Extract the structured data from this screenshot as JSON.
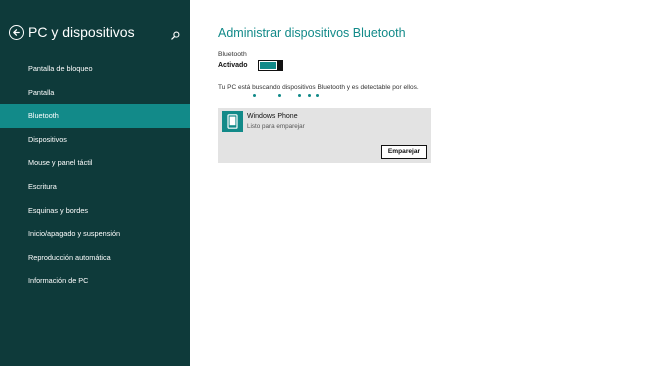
{
  "sidebar": {
    "title": "PC y dispositivos",
    "items": [
      {
        "label": "Pantalla de bloqueo"
      },
      {
        "label": "Pantalla"
      },
      {
        "label": "Bluetooth"
      },
      {
        "label": "Dispositivos"
      },
      {
        "label": "Mouse y panel táctil"
      },
      {
        "label": "Escritura"
      },
      {
        "label": "Esquinas y bordes"
      },
      {
        "label": "Inicio/apagado y suspensión"
      },
      {
        "label": "Reproducción automática"
      },
      {
        "label": "Información de PC"
      }
    ],
    "active_item": "Bluetooth",
    "icons": {
      "back": "back-arrow-icon",
      "search": "search-icon"
    }
  },
  "main": {
    "title": "Administrar dispositivos Bluetooth",
    "bluetooth_label": "Bluetooth",
    "bluetooth_state": "Activado",
    "bluetooth_on": true,
    "scanning_text": "Tu PC está buscando dispositivos Bluetooth y es detectable por ellos.",
    "device": {
      "name": "Windows Phone",
      "status": "Listo para emparejar",
      "icon": "phone-icon",
      "pair_label": "Emparejar"
    }
  },
  "colors": {
    "sidebar_bg": "#0e3a3a",
    "accent": "#128a89",
    "card_bg": "#e3e3e3"
  }
}
